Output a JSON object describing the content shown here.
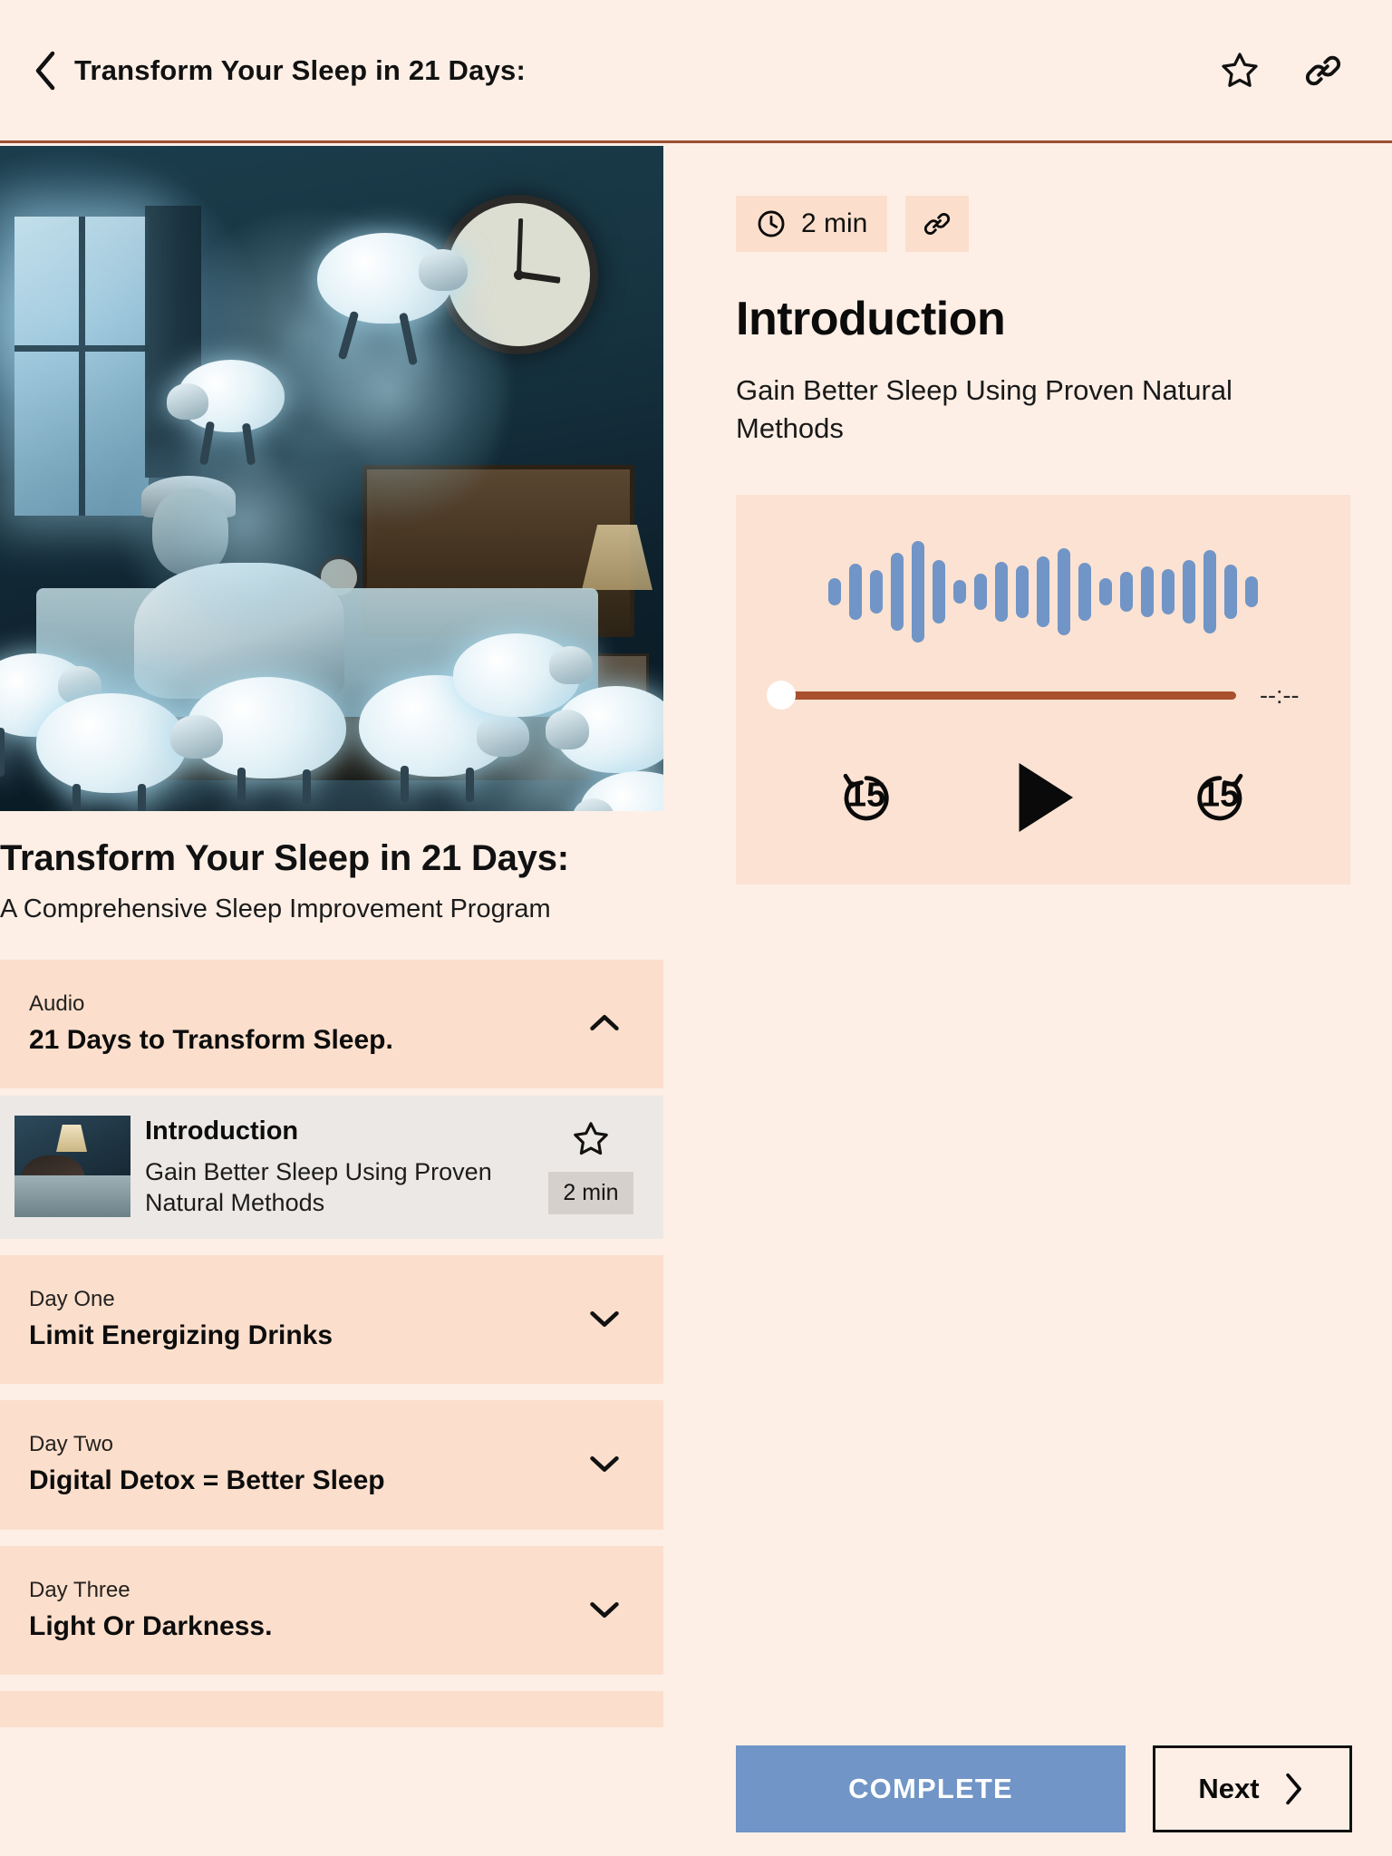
{
  "topbar": {
    "title": "Transform Your Sleep in 21 Days:",
    "back_icon": "chevron-left-icon",
    "favorite_icon": "star-outline-icon",
    "share_icon": "link-icon"
  },
  "course": {
    "title": "Transform Your Sleep in 21 Days:",
    "subtitle": "A Comprehensive Sleep Improvement Program",
    "hero_alt": "Insomniac man in bed at night with glowing sheep and wall clock"
  },
  "sections": [
    {
      "eyebrow": "Audio",
      "heading": "21 Days to Transform Sleep.",
      "expanded": true,
      "chevron": "chevron-up-icon"
    },
    {
      "eyebrow": "Day One",
      "heading": "Limit Energizing Drinks",
      "expanded": false,
      "chevron": "chevron-down-icon"
    },
    {
      "eyebrow": "Day Two",
      "heading": "Digital Detox = Better Sleep",
      "expanded": false,
      "chevron": "chevron-down-icon"
    },
    {
      "eyebrow": "Day Three",
      "heading": "Light Or Darkness.",
      "expanded": false,
      "chevron": "chevron-down-icon"
    }
  ],
  "lesson_item": {
    "title": "Introduction",
    "description": "Gain Better Sleep Using Proven Natural Methods",
    "duration": "2 min",
    "favorite_icon": "star-outline-icon",
    "thumb_alt": "Woman sleeping in bed with a lit lamp"
  },
  "detail": {
    "duration_badge": "2 min",
    "clock_icon": "clock-icon",
    "share_icon": "link-icon",
    "title": "Introduction",
    "subtitle": "Gain Better Sleep Using Proven Natural Methods"
  },
  "player": {
    "current_time": "--:--",
    "progress_percent": 0,
    "rewind_label": "15",
    "forward_label": "15",
    "rewind_icon": "rewind-15-icon",
    "play_icon": "play-icon",
    "forward_icon": "forward-15-icon",
    "waveform": [
      30,
      62,
      48,
      86,
      112,
      70,
      26,
      40,
      66,
      58,
      78,
      96,
      64,
      30,
      44,
      56,
      50,
      70,
      92,
      60,
      34
    ],
    "waveform_color": "#7195c6",
    "track_color": "#a9512f",
    "panel_color": "#fbe2d2"
  },
  "footer": {
    "complete_label": "COMPLETE",
    "next_label": "Next",
    "next_icon": "chevron-right-icon",
    "complete_color": "#7195c6"
  }
}
